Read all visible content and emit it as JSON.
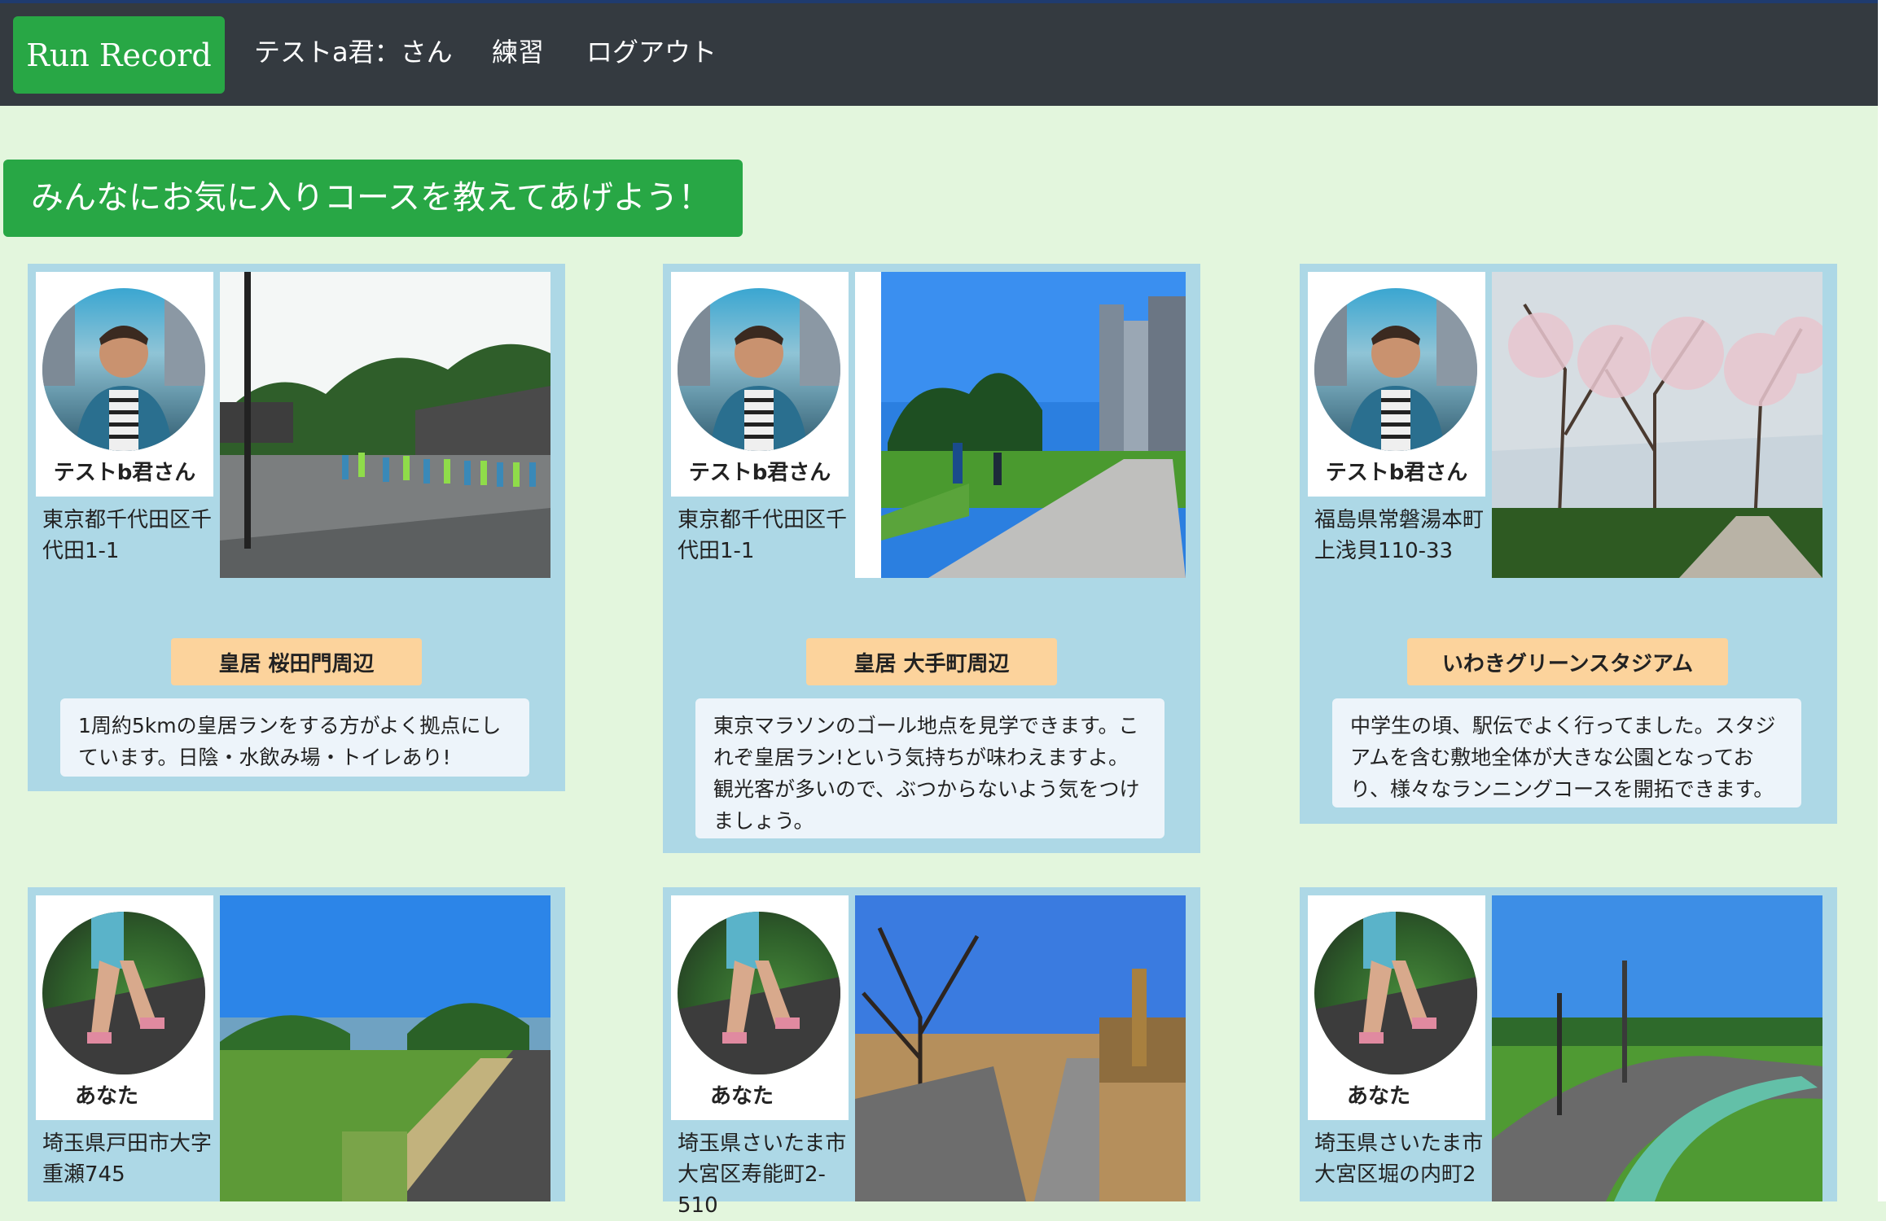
{
  "nav": {
    "brand": "Run Record",
    "user_label": "テストa君：さん",
    "practice": "練習",
    "logout": "ログアウト"
  },
  "banner": {
    "text": "みんなにお気に入りコースを教えてあげよう！"
  },
  "cards": [
    {
      "user": "テストb君さん",
      "address": "東京都千代田区千代田1-1",
      "course": "皇居 桜田門周辺",
      "comment": "1周約5kmの皇居ランをする方がよく拠点にしています。日陰・水飲み場・トイレあり!"
    },
    {
      "user": "テストb君さん",
      "address": "東京都千代田区千代田1-1",
      "course": "皇居 大手町周辺",
      "comment": "東京マラソンのゴール地点を見学できます。これぞ皇居ラン!という気持ちが味わえますよ。観光客が多いので、ぶつからないよう気をつけましょう。"
    },
    {
      "user": "テストb君さん",
      "address": "福島県常磐湯本町上浅貝110-33",
      "course": "いわきグリーンスタジアム",
      "comment": "中学生の頃、駅伝でよく行ってました。スタジアムを含む敷地全体が大きな公園となっており、様々なランニングコースを開拓できます。"
    },
    {
      "user": "あなた",
      "address": "埼玉県戸田市大字重瀬745"
    },
    {
      "user": "あなた",
      "address": "埼玉県さいたま市大宮区寿能町2-510"
    },
    {
      "user": "あなた",
      "address": "埼玉県さいたま市大宮区堀の内町2"
    }
  ],
  "colors": {
    "navbar": "#343a40",
    "brand_green": "#28a745",
    "page_bg": "#e3f6dd",
    "card_bg": "#add8e6",
    "course_button": "#fcd39c",
    "comment_bg": "#edf4fa"
  }
}
